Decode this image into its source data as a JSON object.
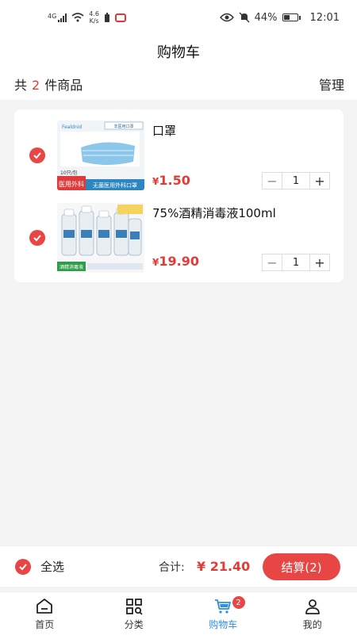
{
  "status_bar": {
    "network_type": "4G",
    "speed": "4.6",
    "speed_unit": "K/s",
    "battery": "44%",
    "time": "12:01"
  },
  "header": {
    "title": "购物车"
  },
  "summary": {
    "prefix": "共",
    "count": "2",
    "suffix": "件商品",
    "manage_label": "管理"
  },
  "cart": {
    "items": [
      {
        "name": "口罩",
        "currency": "¥",
        "price": "1.50",
        "quantity": "1",
        "image": {
          "brand": "Fealdnid",
          "tag": "非医用口罩",
          "pack": "10只/包",
          "badge": "医用外科",
          "banner": "无菌医用外科口罩"
        }
      },
      {
        "name": "75%酒精消毒液100ml",
        "currency": "¥",
        "price": "19.90",
        "quantity": "1",
        "image": {
          "badge": "酒精消毒液"
        }
      }
    ]
  },
  "checkout": {
    "select_all_label": "全选",
    "total_label": "合计:",
    "total": "¥ 21.40",
    "pay_button": "结算(2)"
  },
  "tabbar": {
    "tabs": [
      {
        "label": "首页",
        "icon": "home-icon"
      },
      {
        "label": "分类",
        "icon": "category-icon"
      },
      {
        "label": "购物车",
        "icon": "cart-icon",
        "badge": "2",
        "active": true
      },
      {
        "label": "我的",
        "icon": "user-icon"
      }
    ]
  },
  "colors": {
    "accent": "#e84644",
    "price": "#e33b36",
    "tab_active": "#2f8fe0"
  }
}
